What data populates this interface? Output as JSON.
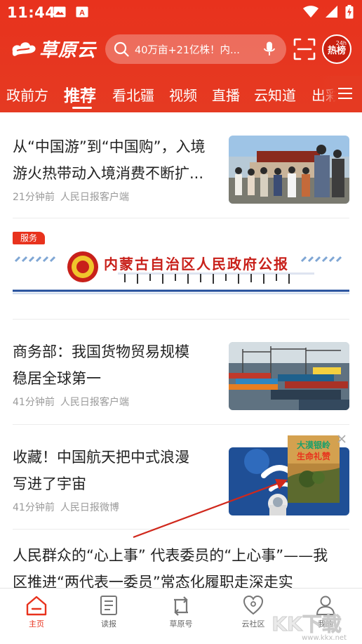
{
  "status": {
    "time": "11:44"
  },
  "header": {
    "logo_text": "草原云",
    "search_placeholder": "40万亩+21亿株！内...",
    "hot_label": "热榜",
    "hot_badge": "24h"
  },
  "tabs": [
    {
      "label": "政前方"
    },
    {
      "label": "推荐",
      "active": true
    },
    {
      "label": "看北疆"
    },
    {
      "label": "视频"
    },
    {
      "label": "直播"
    },
    {
      "label": "云知道"
    },
    {
      "label": "出彩"
    }
  ],
  "feed": {
    "items": [
      {
        "title_line1": "从“中国游”到“中国购”，入境",
        "title_line2": "游火热带动入境消费不断扩...",
        "time": "21分钟前",
        "source": "人民日报客户端"
      },
      {
        "title_line1": "商务部：我国货物贸易规模",
        "title_line2": "稳居全球第一",
        "time": "41分钟前",
        "source": "人民日报客户端"
      },
      {
        "title_line1": "收藏！中国航天把中式浪漫",
        "title_line2": "写进了宇宙",
        "time": "41分钟前",
        "source": "人民日报微博"
      },
      {
        "title_line1": "人民群众的“心上事” 代表委员的“上心事”——我",
        "title_line2": "区推进“两代表一委员”常态化履职走深走实"
      }
    ],
    "ad": {
      "tag": "服务",
      "banner_title": "内蒙古自治区人民政府公报"
    },
    "float_ad": {
      "line1": "大漠银岭",
      "line2": "生命礼赞"
    }
  },
  "bottom_nav": [
    {
      "label": "主页",
      "active": true
    },
    {
      "label": "读报"
    },
    {
      "label": "草原号"
    },
    {
      "label": "云社区"
    },
    {
      "label": "我的"
    }
  ],
  "watermark": {
    "text": "KK下载",
    "url": "www.kkx.net"
  },
  "colors": {
    "brand": "#e8321d",
    "text": "#222222",
    "meta": "#9a9a9a"
  }
}
